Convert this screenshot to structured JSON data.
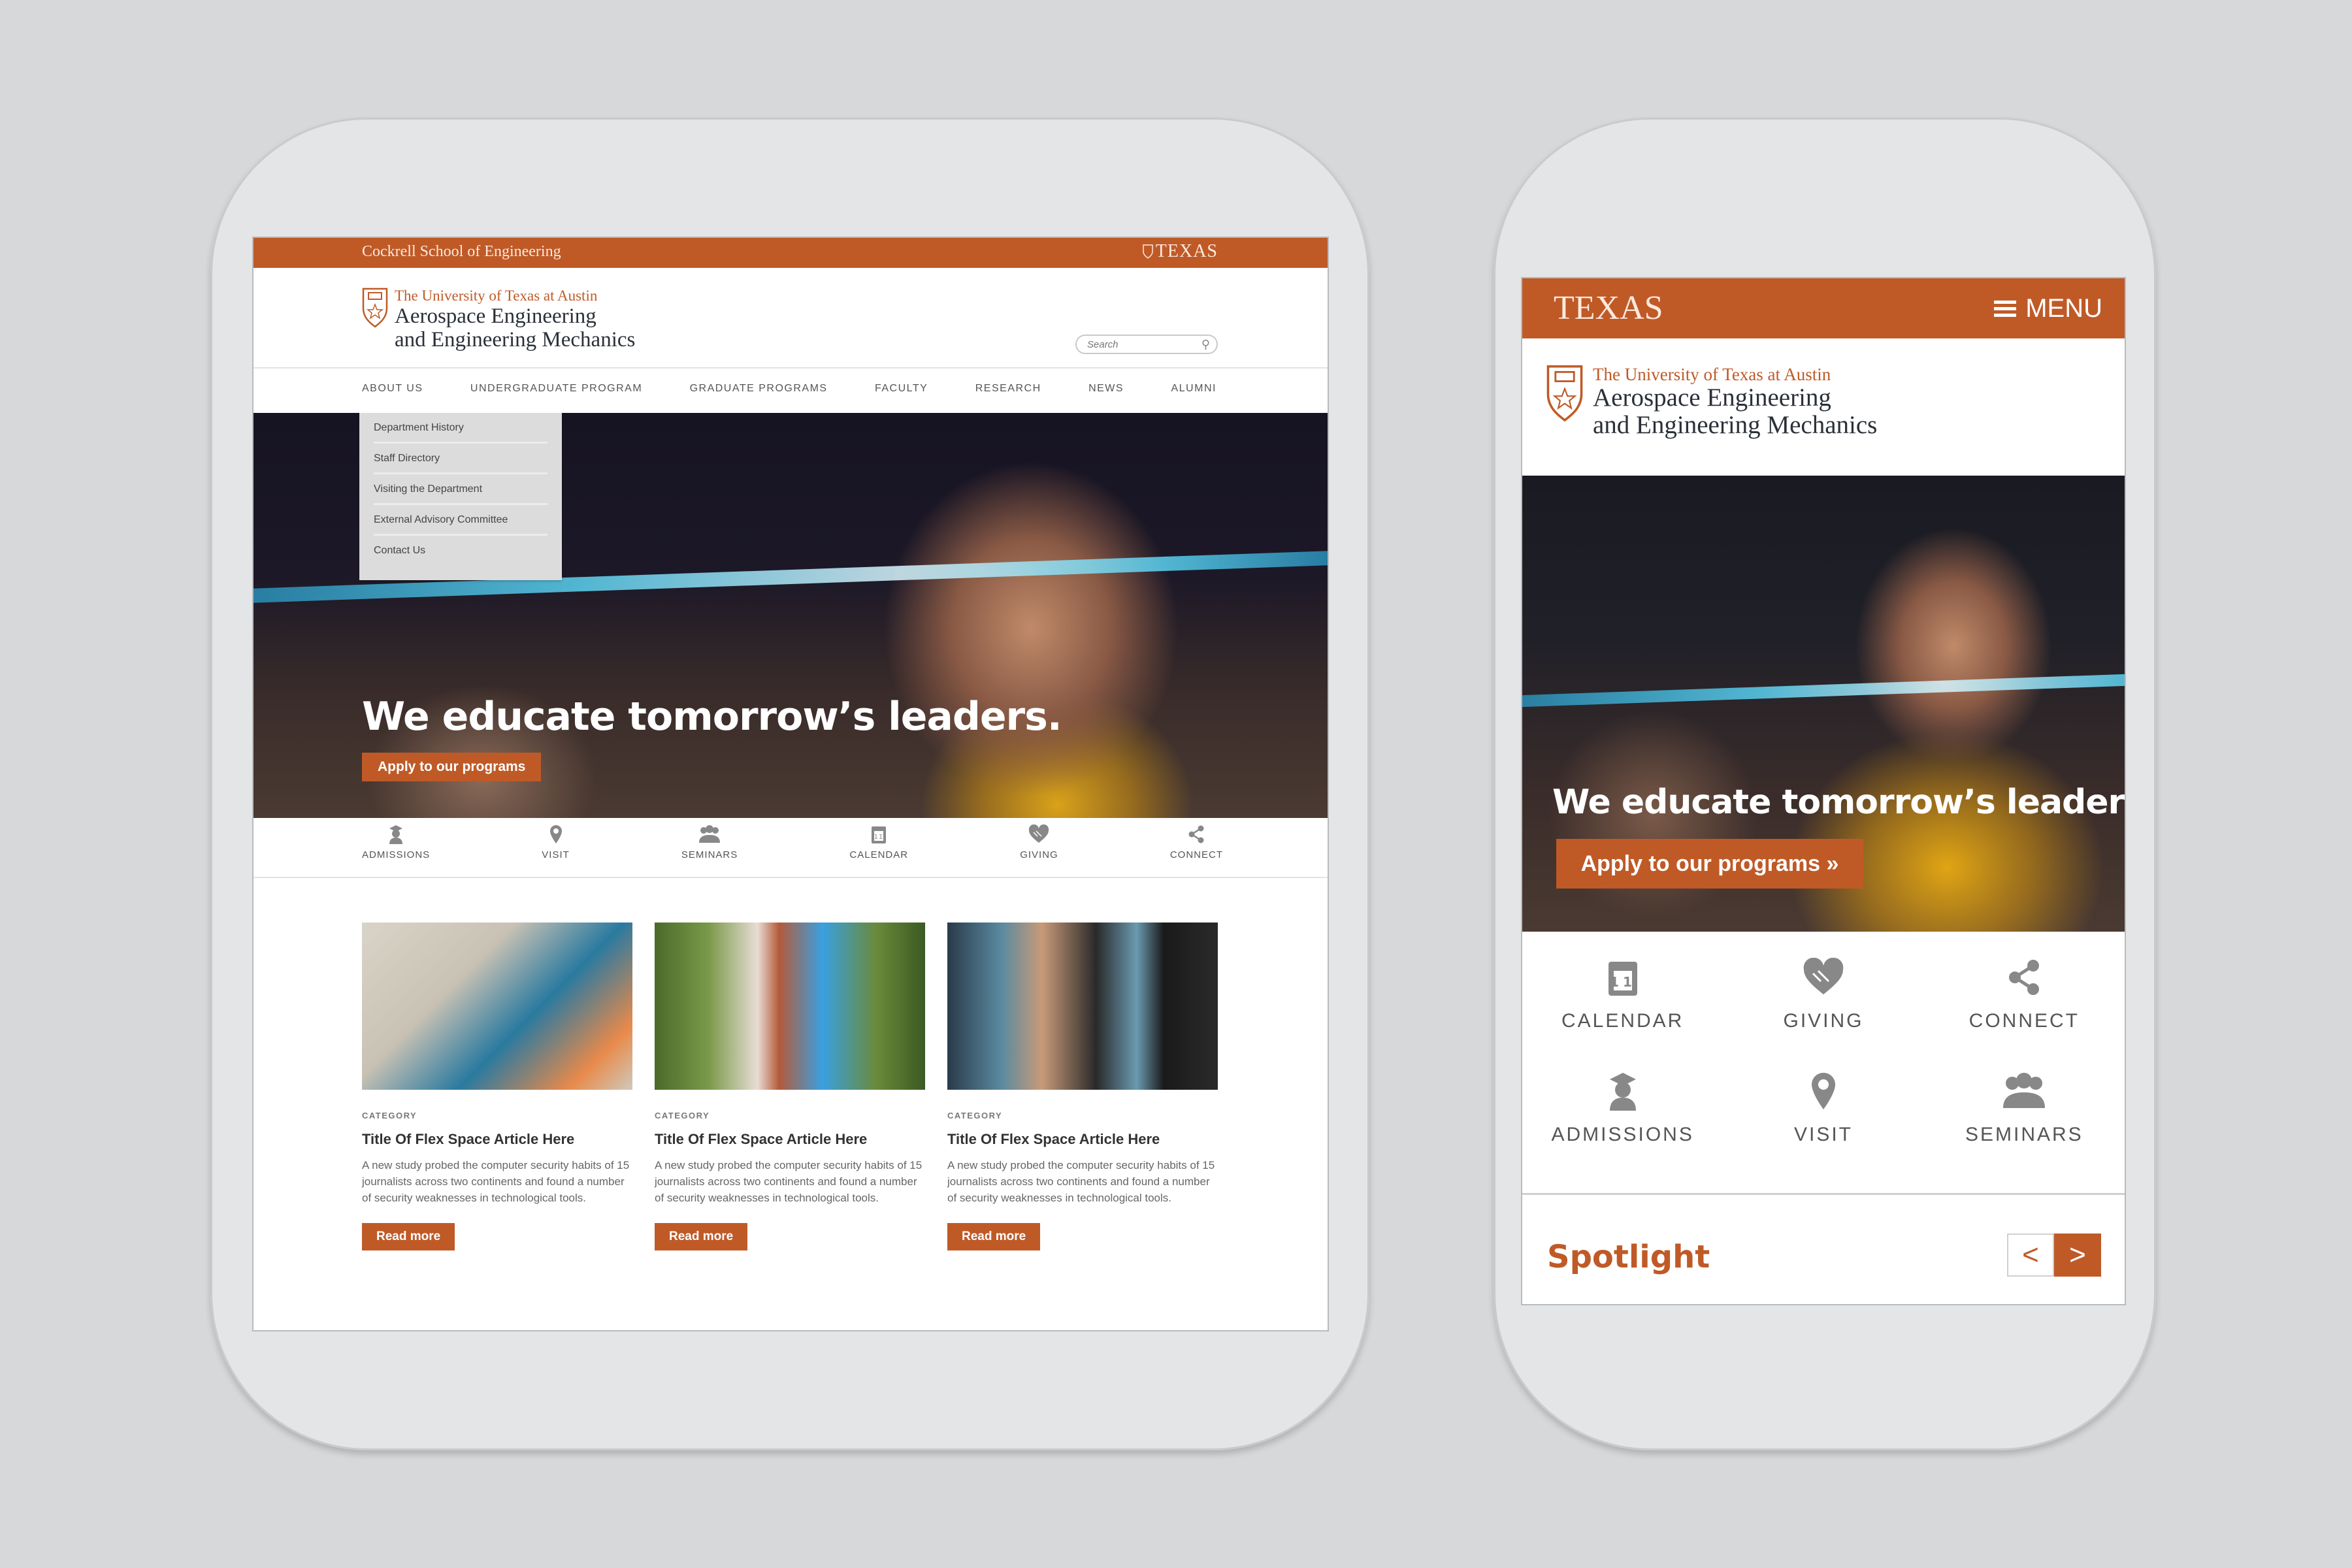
{
  "theme": {
    "accent": "#bf5a27",
    "background": "#d7d8da",
    "device": "#e4e5e7"
  },
  "tablet": {
    "topbar": {
      "school": "Cockrell School of Engineering",
      "texas": "TEXAS"
    },
    "brand": {
      "university": "The University of Texas at Austin",
      "dept_line1": "Aerospace Engineering",
      "dept_line2": "and Engineering Mechanics"
    },
    "search": {
      "placeholder": "Search"
    },
    "nav": [
      "ABOUT US",
      "UNDERGRADUATE PROGRAM",
      "GRADUATE PROGRAMS",
      "FACULTY",
      "RESEARCH",
      "NEWS",
      "ALUMNI"
    ],
    "dropdown": [
      "Department History",
      "Staff Directory",
      "Visiting the Department",
      "External Advisory Committee",
      "Contact Us"
    ],
    "hero": {
      "headline": "We educate tomorrow’s leaders.",
      "cta": "Apply to our programs"
    },
    "quicklinks": [
      {
        "label": "ADMISSIONS",
        "icon": "graduate-icon"
      },
      {
        "label": "VISIT",
        "icon": "map-pin-icon"
      },
      {
        "label": "SEMINARS",
        "icon": "group-icon"
      },
      {
        "label": "CALENDAR",
        "icon": "calendar-icon"
      },
      {
        "label": "GIVING",
        "icon": "heart-hands-icon"
      },
      {
        "label": "CONNECT",
        "icon": "share-icon"
      }
    ],
    "cards": [
      {
        "category": "CATEGORY",
        "title": "Title Of Flex Space  Article Here",
        "body": "A new study probed the computer security habits of 15 journalists across two continents and found a number of security weaknesses in technological tools.",
        "button": "Read more"
      },
      {
        "category": "CATEGORY",
        "title": "Title Of Flex Space  Article Here",
        "body": "A new study probed the computer security habits of 15 journalists across two continents and found a number of security weaknesses in technological tools.",
        "button": "Read more"
      },
      {
        "category": "CATEGORY",
        "title": "Title Of Flex Space  Article Here",
        "body": "A new study probed the computer security habits of 15 journalists across two continents and found a number of security weaknesses in technological tools.",
        "button": "Read more"
      }
    ]
  },
  "phone": {
    "topbar": {
      "texas": "TEXAS",
      "menu": "MENU"
    },
    "brand": {
      "university": "The University of Texas at Austin",
      "dept_line1": "Aerospace Engineering",
      "dept_line2": "and Engineering Mechanics"
    },
    "hero": {
      "headline": "We educate tomorrow’s leaders.",
      "cta": "Apply to our programs »"
    },
    "quicklinks": [
      {
        "label": "CALENDAR",
        "icon": "calendar-icon"
      },
      {
        "label": "GIVING",
        "icon": "heart-hands-icon"
      },
      {
        "label": "CONNECT",
        "icon": "share-icon"
      },
      {
        "label": "ADMISSIONS",
        "icon": "graduate-icon"
      },
      {
        "label": "VISIT",
        "icon": "map-pin-icon"
      },
      {
        "label": "SEMINARS",
        "icon": "group-icon"
      }
    ],
    "spotlight": {
      "title": "Spotlight",
      "prev": "<",
      "next": ">"
    },
    "calendar_day": "11"
  }
}
